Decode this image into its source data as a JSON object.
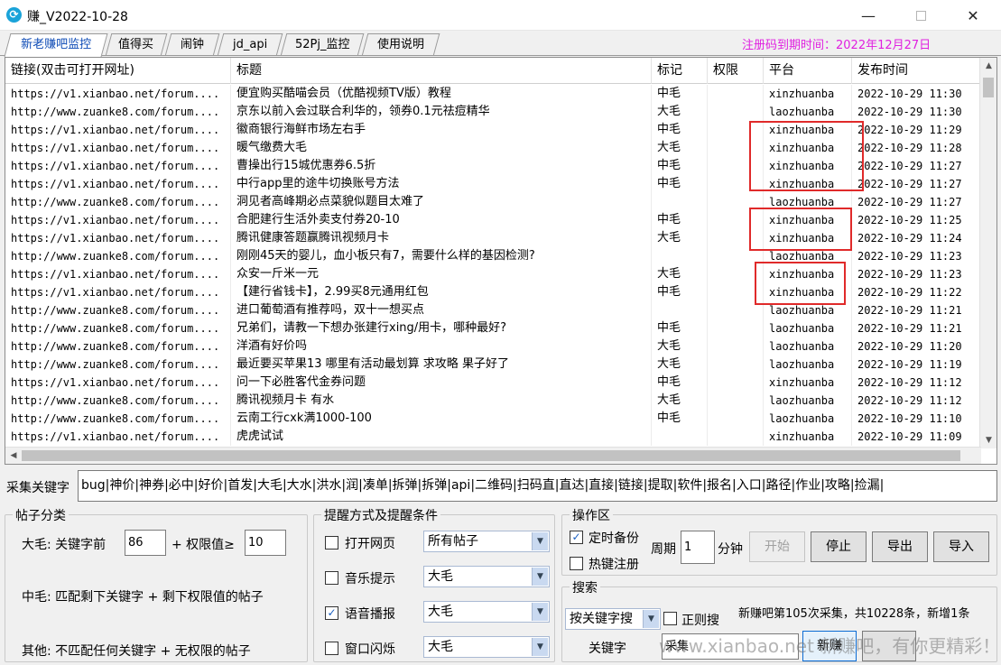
{
  "window": {
    "title": "赚_V2022-10-28",
    "minimize": "—",
    "close": "✕"
  },
  "tabs": [
    {
      "label": "新老赚吧监控",
      "active": true
    },
    {
      "label": "值得买"
    },
    {
      "label": "闹钟"
    },
    {
      "label": "jd_api"
    },
    {
      "label": "52Pj_监控"
    },
    {
      "label": "使用说明"
    }
  ],
  "registration_note": "注册码到期时间：2022年12月27日",
  "table": {
    "columns": [
      "链接(双击可打开网址)",
      "标题",
      "标记",
      "权限",
      "平台",
      "发布时间"
    ],
    "rows": [
      [
        "https://v1.xianbao.net/forum....",
        "便宜购买酷喵会员（优酷视频TV版）教程",
        "中毛",
        "",
        "xinzhuanba",
        "2022-10-29 11:30"
      ],
      [
        "http://www.zuanke8.com/forum....",
        "京东以前入会过联合利华的，领券0.1元祛痘精华",
        "大毛",
        "",
        "laozhuanba",
        "2022-10-29 11:30"
      ],
      [
        "https://v1.xianbao.net/forum....",
        "徽商银行海鲜市场左右手",
        "中毛",
        "",
        "xinzhuanba",
        "2022-10-29 11:29"
      ],
      [
        "https://v1.xianbao.net/forum....",
        "暖气缴费大毛",
        "大毛",
        "",
        "xinzhuanba",
        "2022-10-29 11:28"
      ],
      [
        "https://v1.xianbao.net/forum....",
        "曹操出行15城优惠券6.5折",
        "中毛",
        "",
        "xinzhuanba",
        "2022-10-29 11:27"
      ],
      [
        "https://v1.xianbao.net/forum....",
        "中行app里的途牛切换账号方法",
        "中毛",
        "",
        "xinzhuanba",
        "2022-10-29 11:27"
      ],
      [
        "http://www.zuanke8.com/forum....",
        "洞见者高峰期必点菜貌似题目太难了",
        "",
        "",
        "laozhuanba",
        "2022-10-29 11:27"
      ],
      [
        "https://v1.xianbao.net/forum....",
        "合肥建行生活外卖支付券20-10",
        "中毛",
        "",
        "xinzhuanba",
        "2022-10-29 11:25"
      ],
      [
        "https://v1.xianbao.net/forum....",
        "腾讯健康答题赢腾讯视频月卡",
        "大毛",
        "",
        "xinzhuanba",
        "2022-10-29 11:24"
      ],
      [
        "http://www.zuanke8.com/forum....",
        "刚刚45天的婴儿，血小板只有7，需要什么样的基因检测?",
        "",
        "",
        "laozhuanba",
        "2022-10-29 11:23"
      ],
      [
        "https://v1.xianbao.net/forum....",
        "众安一斤米一元",
        "大毛",
        "",
        "xinzhuanba",
        "2022-10-29 11:23"
      ],
      [
        "https://v1.xianbao.net/forum....",
        "【建行省钱卡】，2.99买8元通用红包",
        "中毛",
        "",
        "xinzhuanba",
        "2022-10-29 11:22"
      ],
      [
        "http://www.zuanke8.com/forum....",
        "进口葡萄酒有推荐吗，双十一想买点",
        "",
        "",
        "laozhuanba",
        "2022-10-29 11:21"
      ],
      [
        "http://www.zuanke8.com/forum....",
        "兄弟们，请教一下想办张建行xing/用卡，哪种最好?",
        "中毛",
        "",
        "laozhuanba",
        "2022-10-29 11:21"
      ],
      [
        "http://www.zuanke8.com/forum....",
        "洋酒有好价吗",
        "大毛",
        "",
        "laozhuanba",
        "2022-10-29 11:20"
      ],
      [
        "http://www.zuanke8.com/forum....",
        "最近要买苹果13 哪里有活动最划算 求攻略 果子好了",
        "大毛",
        "",
        "laozhuanba",
        "2022-10-29 11:19"
      ],
      [
        "https://v1.xianbao.net/forum....",
        "问一下必胜客代金券问题",
        "中毛",
        "",
        "xinzhuanba",
        "2022-10-29 11:12"
      ],
      [
        "http://www.zuanke8.com/forum....",
        "腾讯视频月卡 有水",
        "大毛",
        "",
        "laozhuanba",
        "2022-10-29 11:12"
      ],
      [
        "http://www.zuanke8.com/forum....",
        "云南工行cxk满1000-100",
        "中毛",
        "",
        "laozhuanba",
        "2022-10-29 11:10"
      ],
      [
        "https://v1.xianbao.net/forum....",
        "虎虎试试",
        "",
        "",
        "xinzhuanba",
        "2022-10-29 11:09"
      ]
    ]
  },
  "keywords": {
    "label": "采集关键字",
    "value": "bug|神价|神券|必中|好价|首发|大毛|大水|洪水|润|凑单|拆弹|拆弹|api|二维码|扫码直|直达|直接|链接|提取|软件|报名|入口|路径|作业|攻略|捡漏|"
  },
  "post_classify": {
    "title": "帖子分类",
    "big_prefix": "大毛: 关键字前",
    "big_num": "86",
    "big_mid": "+ 权限值≥",
    "big_threshold": "10",
    "mid": "中毛: 匹配剩下关键字 + 剩下权限值的帖子",
    "other": "其他: 不匹配任何关键字 + 无权限的帖子"
  },
  "reminder": {
    "title": "提醒方式及提醒条件",
    "items": [
      {
        "label": "打开网页",
        "checked": false,
        "select": "所有帖子"
      },
      {
        "label": "音乐提示",
        "checked": false,
        "select": "大毛"
      },
      {
        "label": "语音播报",
        "checked": true,
        "select": "大毛"
      },
      {
        "label": "窗口闪烁",
        "checked": false,
        "select": "大毛"
      }
    ]
  },
  "operation": {
    "title": "操作区",
    "timed_backup": "定时备份",
    "hotkey_register": "热键注册",
    "period_label": "周期",
    "period_value": "1",
    "period_unit": "分钟",
    "start": "开始",
    "stop": "停止",
    "export": "导出",
    "import": "导入"
  },
  "search": {
    "title": "搜索",
    "mode": "按关键字搜",
    "regex": "正则搜",
    "status": "新赚吧第105次采集，共10228条，新增1条",
    "keyword_label": "关键字",
    "keyword_value": "采集",
    "new_button": "新赚"
  },
  "watermark": "www.xianbao.net  新赚吧，有你更精彩！",
  "colors": {
    "highlight": "#e02a2a",
    "reg_note": "#e020e0",
    "active_tab": "#0b49b5"
  }
}
